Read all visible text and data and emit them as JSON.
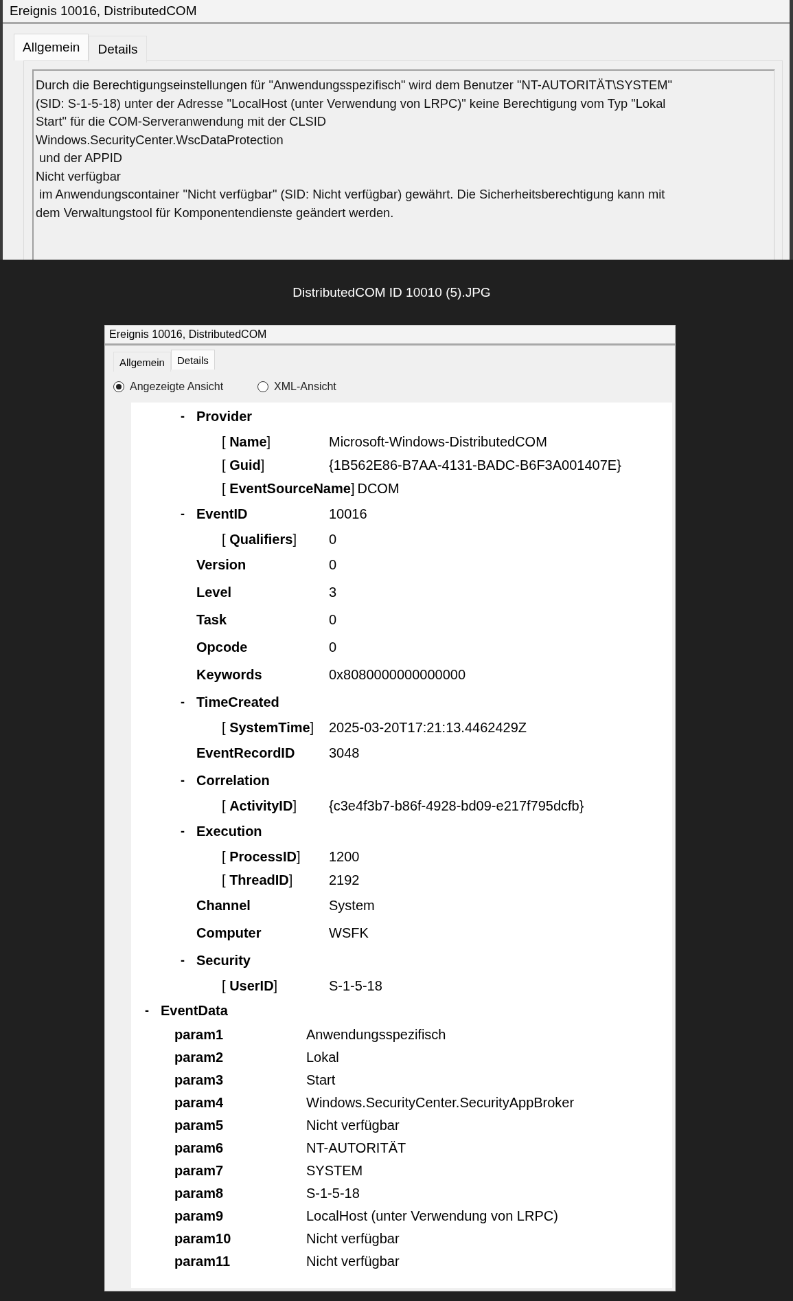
{
  "top_window": {
    "title": "Ereignis 10016, DistributedCOM",
    "tabs": [
      {
        "label": "Allgemein",
        "selected": true
      },
      {
        "label": "Details",
        "selected": false
      }
    ],
    "description": "Durch die Berechtigungseinstellungen für \"Anwendungsspezifisch\" wird dem Benutzer \"NT-AUTORITÄT\\SYSTEM\"\n(SID: S-1-5-18) unter der Adresse \"LocalHost (unter Verwendung von LRPC)\" keine Berechtigung vom Typ \"Lokal\nStart\" für die COM-Serveranwendung mit der CLSID\nWindows.SecurityCenter.WscDataProtection\n und der APPID\nNicht verfügbar\n im Anwendungscontainer \"Nicht verfügbar\" (SID: Nicht verfügbar) gewährt. Die Sicherheitsberechtigung kann mit\ndem Verwaltungstool für Komponentendienste geändert werden."
  },
  "caption": "DistributedCOM ID 10010 (5).JPG",
  "detail_window": {
    "title": "Ereignis 10016, DistributedCOM",
    "tabs": [
      {
        "label": "Allgemein",
        "selected": false
      },
      {
        "label": "Details",
        "selected": true
      }
    ],
    "view_options": [
      {
        "label": "Angezeigte Ansicht",
        "selected": true
      },
      {
        "label": "XML-Ansicht",
        "selected": false
      }
    ],
    "system_nodes": [
      {
        "kind": "section",
        "toggle": "-",
        "label": "Provider",
        "children": [
          {
            "kind": "attribute",
            "label": "[ **Name**]",
            "value": "Microsoft-Windows-DistributedCOM"
          },
          {
            "kind": "attribute",
            "label": "[ **Guid**]",
            "value": "{1B562E86-B7AA-4131-BADC-B6F3A001407E}"
          },
          {
            "kind": "attribute",
            "label": "[ **EventSourceName**]",
            "value": "DCOM"
          }
        ]
      },
      {
        "kind": "section",
        "toggle": "-",
        "label": "EventID",
        "value": "10016",
        "children": [
          {
            "kind": "attribute",
            "label": "[ **Qualifiers**]",
            "value": "0"
          }
        ]
      },
      {
        "kind": "field",
        "label": "Version",
        "value": "0"
      },
      {
        "kind": "field",
        "label": "Level",
        "value": "3"
      },
      {
        "kind": "field",
        "label": "Task",
        "value": "0"
      },
      {
        "kind": "field",
        "label": "Opcode",
        "value": "0"
      },
      {
        "kind": "field",
        "label": "Keywords",
        "value": "0x8080000000000000"
      },
      {
        "kind": "section",
        "toggle": "-",
        "label": "TimeCreated",
        "children": [
          {
            "kind": "attribute",
            "label": "[ **SystemTime**]",
            "value": "2025-03-20T17:21:13.4462429Z"
          }
        ]
      },
      {
        "kind": "field",
        "label": "EventRecordID",
        "value": "3048"
      },
      {
        "kind": "section",
        "toggle": "-",
        "label": "Correlation",
        "children": [
          {
            "kind": "attribute",
            "label": "[ **ActivityID**]",
            "value": "{c3e4f3b7-b86f-4928-bd09-e217f795dcfb}"
          }
        ]
      },
      {
        "kind": "section",
        "toggle": "-",
        "label": "Execution",
        "children": [
          {
            "kind": "attribute",
            "label": "[ **ProcessID**]",
            "value": "1200"
          },
          {
            "kind": "attribute",
            "label": "[ **ThreadID**]",
            "value": "2192"
          }
        ]
      },
      {
        "kind": "field",
        "label": "Channel",
        "value": "System"
      },
      {
        "kind": "field",
        "label": "Computer",
        "value": "WSFK"
      },
      {
        "kind": "section",
        "toggle": "-",
        "label": "Security",
        "children": [
          {
            "kind": "attribute",
            "label": "[ **UserID**]",
            "value": "S-1-5-18"
          }
        ]
      }
    ],
    "event_data": {
      "toggle": "-",
      "label": "EventData",
      "params": [
        {
          "label": "param1",
          "value": "Anwendungsspezifisch"
        },
        {
          "label": "param2",
          "value": "Lokal"
        },
        {
          "label": "param3",
          "value": "Start"
        },
        {
          "label": "param4",
          "value": "Windows.SecurityCenter.SecurityAppBroker"
        },
        {
          "label": "param5",
          "value": "Nicht verfügbar"
        },
        {
          "label": "param6",
          "value": "NT-AUTORITÄT"
        },
        {
          "label": "param7",
          "value": "SYSTEM"
        },
        {
          "label": "param8",
          "value": "S-1-5-18"
        },
        {
          "label": "param9",
          "value": "LocalHost (unter Verwendung von LRPC)"
        },
        {
          "label": "param10",
          "value": "Nicht verfügbar"
        },
        {
          "label": "param11",
          "value": "Nicht verfügbar"
        }
      ]
    }
  }
}
